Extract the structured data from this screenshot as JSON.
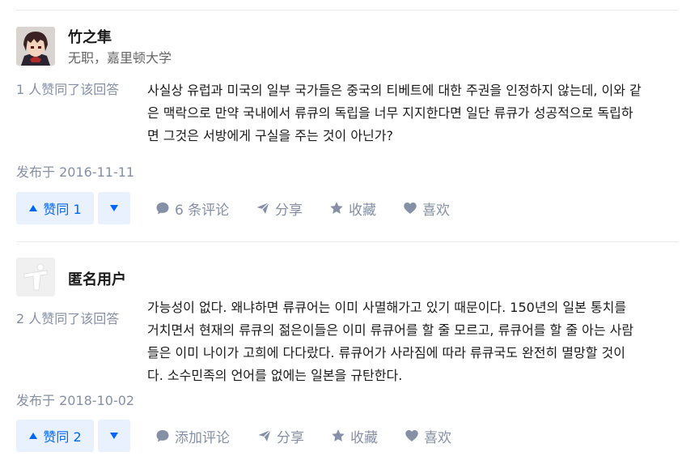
{
  "colors": {
    "accent": "#0066ff",
    "vote_bg": "#e8f1fd",
    "meta_text": "#8590a6",
    "divider": "#ebebeb"
  },
  "answers": [
    {
      "author": {
        "name": "竹之隼",
        "headline": "无职，嘉里顿大学",
        "avatar": "anime-avatar"
      },
      "vote_count_text": "1 人赞同了该回答",
      "content_lines": [
        "사실상 유럽과 미국의 일부 국가들은 중국의 티베트에 대한 주권을 인정하지 않는데, 이와 같",
        "은 맥락으로 만약 국내에서 류큐의 독립을 너무 지지한다면 일단 류큐가 성공적으로 독립하",
        "면 그것은 서방에게 구실을 주는 것이 아닌가?"
      ],
      "published": "发布于 2016-11-11",
      "actions": {
        "vote_up": "赞同 1",
        "comment": "6 条评论",
        "share": "分享",
        "collect": "收藏",
        "like": "喜欢"
      }
    },
    {
      "author": {
        "name": "匿名用户",
        "headline": "",
        "avatar": "anonymous-avatar"
      },
      "vote_count_text": "2 人赞同了该回答",
      "content_lines": [
        "가능성이 없다. 왜냐하면 류큐어는 이미 사멸해가고 있기 때문이다. 150년의 일본 통치를",
        "거치면서 현재의 류큐의 젊은이들은 이미 류큐어를 할 줄 모르고, 류큐어를 할 줄 아는 사람",
        "들은 이미 나이가 고희에 다다랐다. 류큐어가 사라짐에 따라 류큐국도 완전히 멸망할 것이",
        "다. 소수민족의 언어를 없에는 일본을 규탄한다."
      ],
      "published": "发布于 2018-10-02",
      "actions": {
        "vote_up": "赞同 2",
        "comment": "添加评论",
        "share": "分享",
        "collect": "收藏",
        "like": "喜欢"
      }
    }
  ]
}
